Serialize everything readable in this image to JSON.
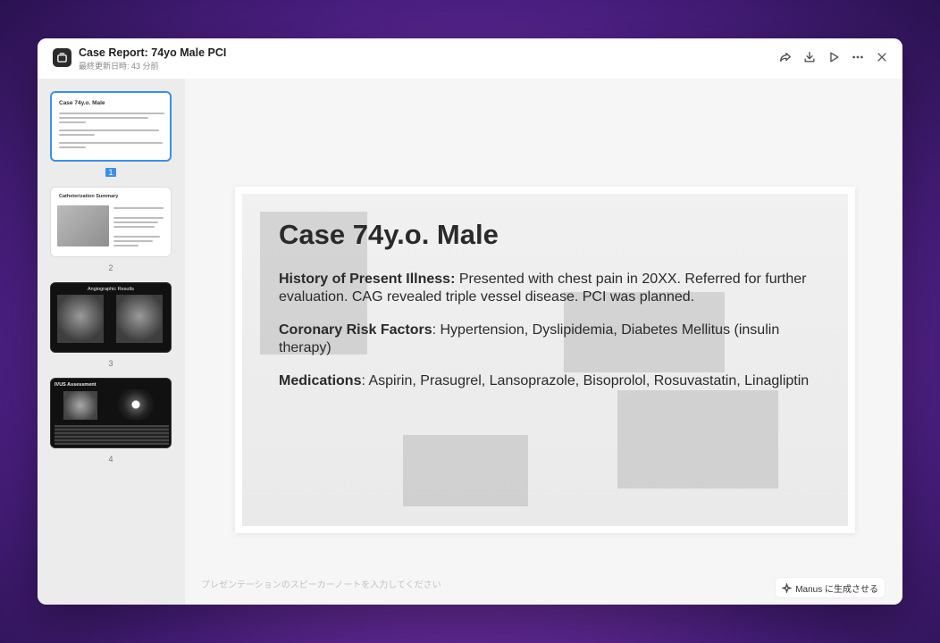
{
  "window": {
    "title": "Case Report: 74yo Male PCI",
    "subtitle": "最終更新日時: 43 分前"
  },
  "toolbar": {
    "icons": [
      "share-icon",
      "download-icon",
      "play-icon",
      "more-icon",
      "close-icon"
    ]
  },
  "sidebar": {
    "thumbnails": [
      {
        "number": "1",
        "title": "Case 74y.o. Male",
        "active": true
      },
      {
        "number": "2",
        "title": "Catheterization Summary",
        "active": false
      },
      {
        "number": "3",
        "title": "Angiographic Results",
        "active": false
      },
      {
        "number": "4",
        "title": "IVUS Assessment",
        "active": false
      }
    ]
  },
  "slide": {
    "title": "Case 74y.o. Male",
    "hpi_label": "History of Present Illness:",
    "hpi_text": " Presented with chest pain in 20XX. Referred for further evaluation. CAG revealed triple vessel disease. PCI was planned.",
    "risk_label": "Coronary Risk Factors",
    "risk_text": ": Hypertension, Dyslipidemia, Diabetes Mellitus (insulin therapy)",
    "med_label": "Medications",
    "med_text": ": Aspirin, Prasugrel, Lansoprazole, Bisoprolol, Rosuvastatin, Linagliptin"
  },
  "notes": {
    "placeholder": "プレゼンテーションのスピーカーノートを入力してください"
  },
  "generate_button": {
    "label": "Manus に生成させる"
  },
  "colors": {
    "accent": "#3d8fe6",
    "background_gradient": [
      "#c25bd6",
      "#4b1f82"
    ]
  }
}
